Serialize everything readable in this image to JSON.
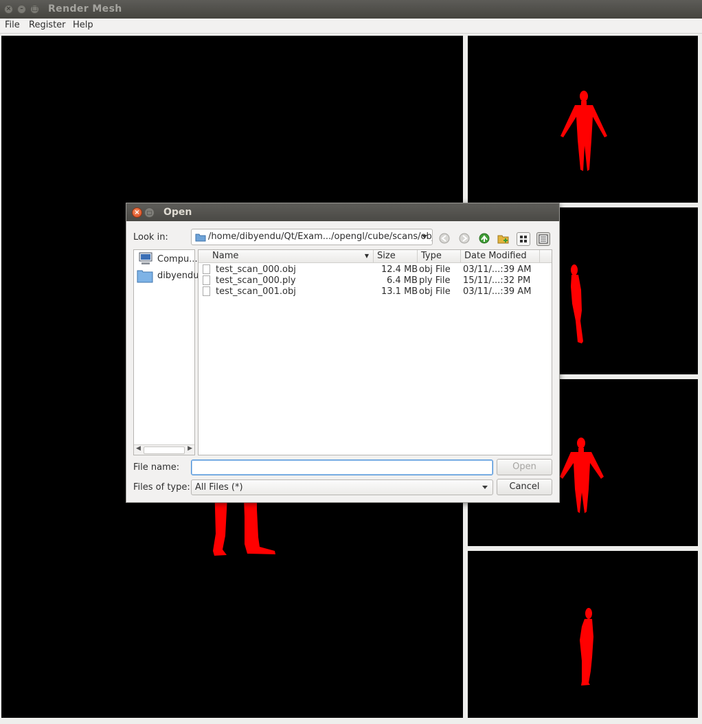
{
  "window": {
    "title": "Render Mesh"
  },
  "menu": {
    "file": "File",
    "register": "Register",
    "help": "Help"
  },
  "colors": {
    "mesh": "#ff0000",
    "viewport_bg": "#000000",
    "accent": "#4a90d9"
  },
  "dialog": {
    "title": "Open",
    "look_in_label": "Look in:",
    "look_in_path": "/home/dibyendu/Qt/Exam.../opengl/cube/scans/obj",
    "toolbar_icons": [
      "back-icon",
      "forward-icon",
      "parent-dir-icon",
      "new-folder-icon",
      "list-view-icon",
      "detail-view-icon"
    ],
    "sidebar": [
      {
        "label": "Compu...",
        "icon": "computer-icon"
      },
      {
        "label": "dibyendu",
        "icon": "folder-icon"
      }
    ],
    "columns": {
      "name": "Name",
      "size": "Size",
      "type": "Type",
      "date": "Date Modified"
    },
    "files": [
      {
        "name": "test_scan_000.obj",
        "size": "12.4 MB",
        "type": "obj File",
        "date": "03/11/...:39 AM"
      },
      {
        "name": "test_scan_000.ply",
        "size": "6.4 MB",
        "type": "ply File",
        "date": "15/11/...:32 PM"
      },
      {
        "name": "test_scan_001.obj",
        "size": "13.1 MB",
        "type": "obj File",
        "date": "03/11/...:39 AM"
      }
    ],
    "file_name_label": "File name:",
    "file_name_value": "",
    "files_of_type_label": "Files of type:",
    "files_of_type_value": "All Files (*)",
    "open_button": "Open",
    "cancel_button": "Cancel"
  }
}
